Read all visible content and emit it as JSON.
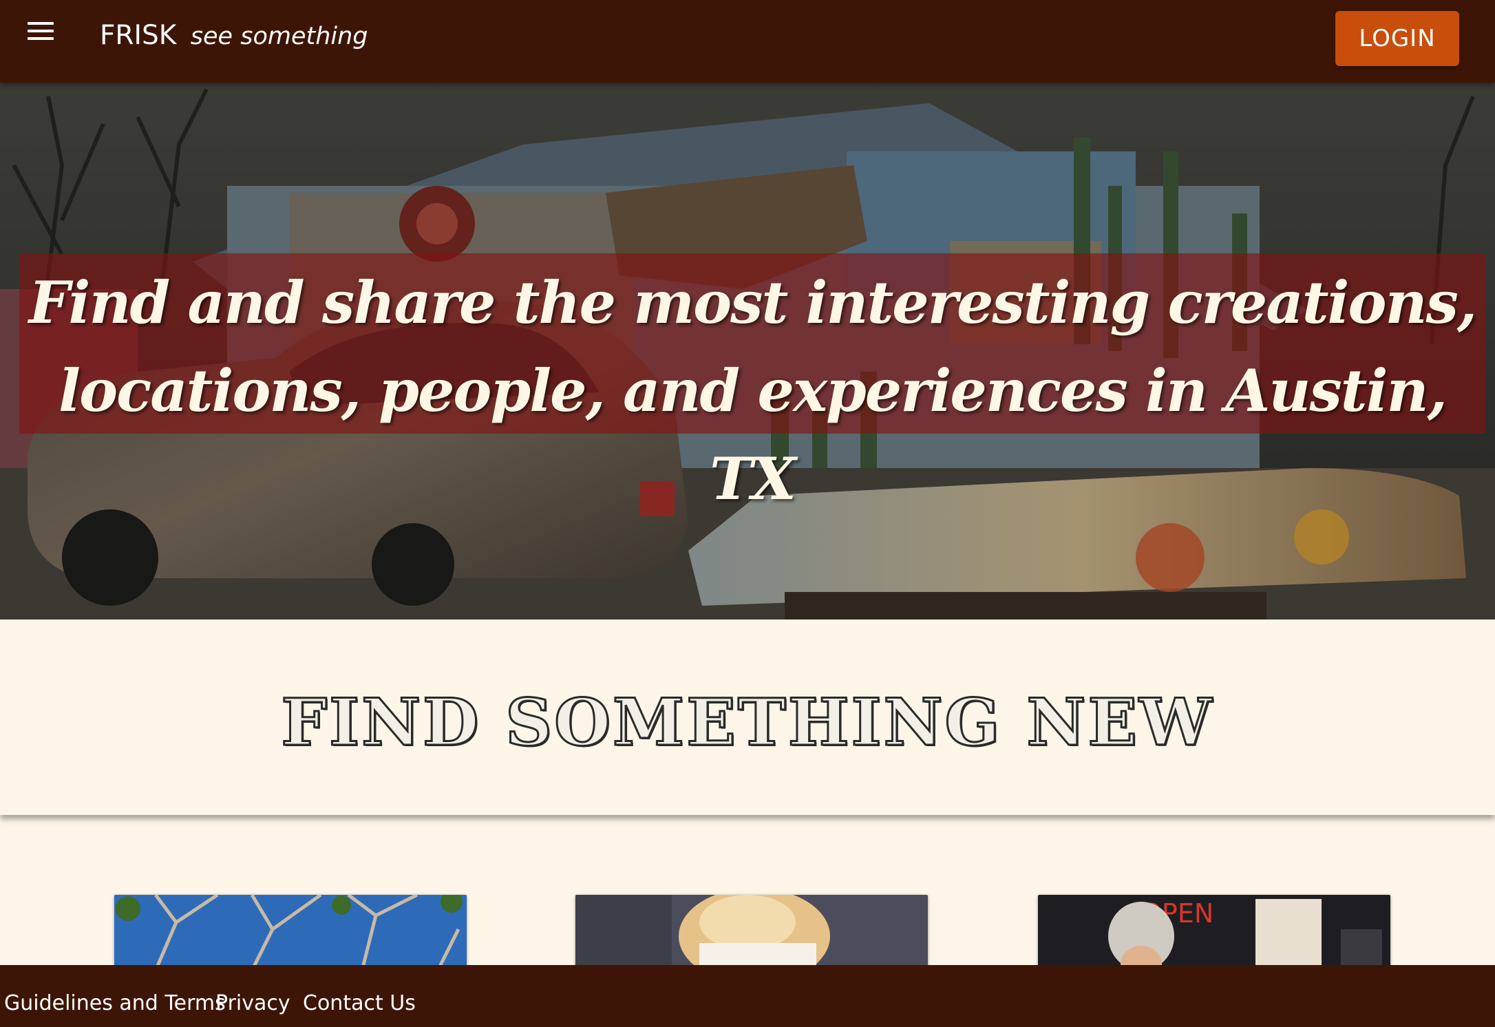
{
  "header": {
    "brand_name": "FRISK",
    "tagline": "see something",
    "login_label": "LOGIN",
    "menu_icon": "hamburger-menu-icon",
    "colors": {
      "bar": "#3d1506",
      "login": "#c94e0b"
    }
  },
  "hero": {
    "line1": "Find and share the most interesting creations,",
    "line2": "locations, people, and experiences in Austin, TX"
  },
  "find": {
    "title": "FIND SOMETHING NEW"
  },
  "cards": [
    {
      "image": "trees-sky-photo"
    },
    {
      "image": "food-dish-photo"
    },
    {
      "image": "storefront-person-photo"
    }
  ],
  "footer": {
    "links": [
      "Guidelines and Terms",
      "Privacy",
      "Contact Us"
    ]
  }
}
